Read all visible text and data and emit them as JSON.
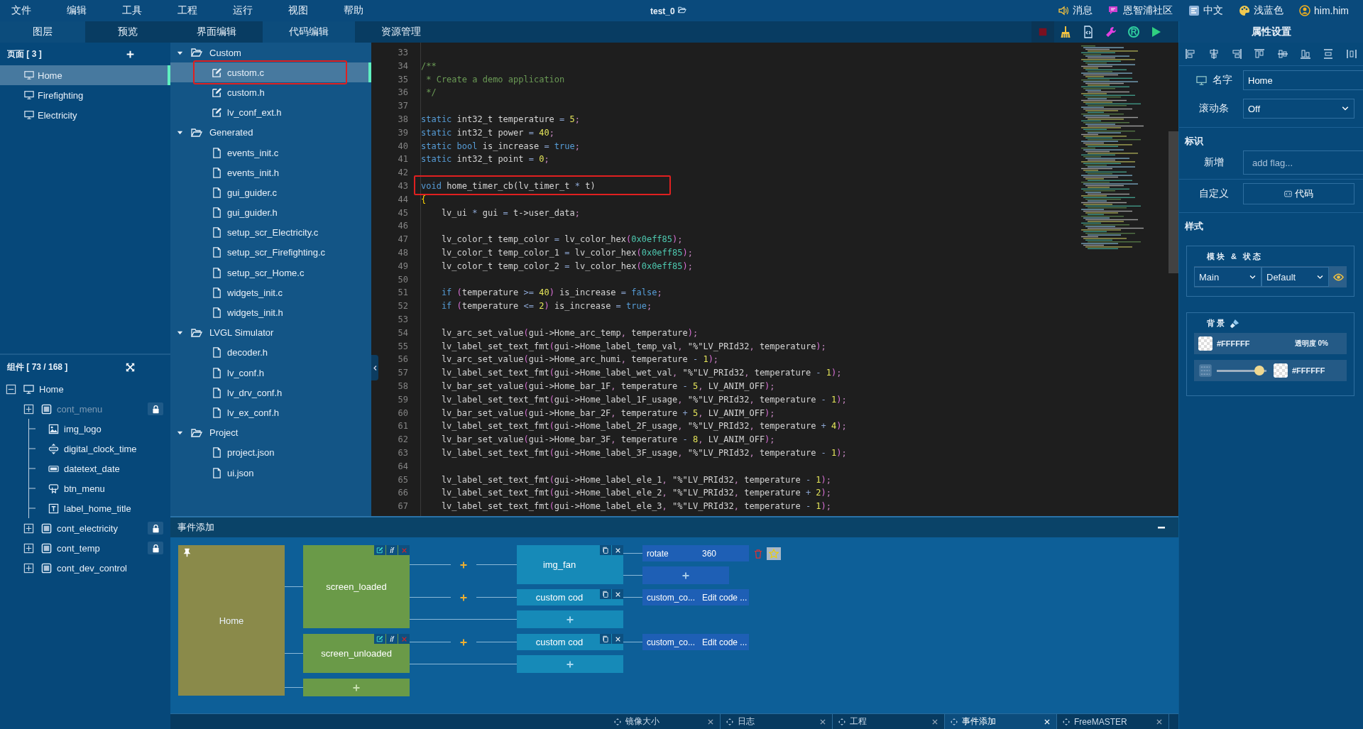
{
  "menubar": {
    "menus": [
      "文件",
      "编辑",
      "工具",
      "工程",
      "运行",
      "视图",
      "帮助"
    ],
    "project_title": "test_0",
    "right_items": [
      {
        "kind": "message",
        "label": "消息"
      },
      {
        "kind": "community",
        "label": "恩智浦社区"
      },
      {
        "kind": "language",
        "label": "中文"
      },
      {
        "kind": "theme",
        "label": "浅蓝色"
      },
      {
        "kind": "user",
        "label": "him.him"
      }
    ]
  },
  "left_tabs": [
    {
      "label": "图层",
      "selected": true
    },
    {
      "label": "预览",
      "selected": false
    }
  ],
  "center_tabs": [
    {
      "label": "界面编辑",
      "selected": false
    },
    {
      "label": "代码编辑",
      "selected": true
    },
    {
      "label": "资源管理",
      "selected": false
    }
  ],
  "toolbar": [
    {
      "kind": "stop"
    },
    {
      "kind": "clean"
    },
    {
      "kind": "export"
    },
    {
      "kind": "tools"
    },
    {
      "kind": "register",
      "label": "R"
    },
    {
      "kind": "run"
    }
  ],
  "pages": {
    "title": "页面 [ 3 ]",
    "items": [
      {
        "label": "Home",
        "selected": true
      },
      {
        "label": "Firefighting",
        "selected": false
      },
      {
        "label": "Electricity",
        "selected": false
      }
    ]
  },
  "components": {
    "title": "组件 [ 73 / 168 ]",
    "tree": [
      {
        "label": "Home",
        "kind": "screen",
        "collapsible": true,
        "expanded": true,
        "locked": false,
        "hidden": false,
        "children": [
          {
            "label": "cont_menu",
            "kind": "container",
            "collapsible": true,
            "expanded": false,
            "locked": true,
            "hidden": true
          },
          {
            "label": "img_logo",
            "kind": "image",
            "collapsible": false,
            "locked": false,
            "hidden": false
          },
          {
            "label": "digital_clock_time",
            "kind": "clock",
            "collapsible": false,
            "locked": false,
            "hidden": false
          },
          {
            "label": "datetext_date",
            "kind": "datetext",
            "collapsible": false,
            "locked": false,
            "hidden": false
          },
          {
            "label": "btn_menu",
            "kind": "button",
            "collapsible": false,
            "locked": false,
            "hidden": false
          },
          {
            "label": "label_home_title",
            "kind": "label",
            "collapsible": false,
            "locked": false,
            "hidden": false
          },
          {
            "label": "cont_electricity",
            "kind": "container",
            "collapsible": true,
            "expanded": false,
            "locked": true,
            "hidden": false
          },
          {
            "label": "cont_temp",
            "kind": "container",
            "collapsible": true,
            "expanded": false,
            "locked": true,
            "hidden": false
          },
          {
            "label": "cont_dev_control",
            "kind": "container",
            "collapsible": true,
            "expanded": false,
            "locked": false,
            "hidden": false
          }
        ]
      }
    ]
  },
  "file_tree": [
    {
      "label": "Custom",
      "expanded": true,
      "children": [
        {
          "label": "custom.c",
          "kind": "editable",
          "selected": true,
          "highlighted": true
        },
        {
          "label": "custom.h",
          "kind": "editable",
          "selected": false,
          "highlighted": false
        },
        {
          "label": "lv_conf_ext.h",
          "kind": "editable",
          "selected": false,
          "highlighted": false
        }
      ]
    },
    {
      "label": "Generated",
      "expanded": true,
      "children": [
        {
          "label": "events_init.c",
          "kind": "file",
          "selected": false,
          "highlighted": false
        },
        {
          "label": "events_init.h",
          "kind": "file",
          "selected": false,
          "highlighted": false
        },
        {
          "label": "gui_guider.c",
          "kind": "file",
          "selected": false,
          "highlighted": false
        },
        {
          "label": "gui_guider.h",
          "kind": "file",
          "selected": false,
          "highlighted": false
        },
        {
          "label": "setup_scr_Electricity.c",
          "kind": "file",
          "selected": false,
          "highlighted": false
        },
        {
          "label": "setup_scr_Firefighting.c",
          "kind": "file",
          "selected": false,
          "highlighted": false
        },
        {
          "label": "setup_scr_Home.c",
          "kind": "file",
          "selected": false,
          "highlighted": false
        },
        {
          "label": "widgets_init.c",
          "kind": "file",
          "selected": false,
          "highlighted": false
        },
        {
          "label": "widgets_init.h",
          "kind": "file",
          "selected": false,
          "highlighted": false
        }
      ]
    },
    {
      "label": "LVGL Simulator",
      "expanded": true,
      "children": [
        {
          "label": "decoder.h",
          "kind": "file",
          "selected": false,
          "highlighted": false
        },
        {
          "label": "lv_conf.h",
          "kind": "file",
          "selected": false,
          "highlighted": false
        },
        {
          "label": "lv_drv_conf.h",
          "kind": "file",
          "selected": false,
          "highlighted": false
        },
        {
          "label": "lv_ex_conf.h",
          "kind": "file",
          "selected": false,
          "highlighted": false
        }
      ]
    },
    {
      "label": "Project",
      "expanded": true,
      "children": [
        {
          "label": "project.json",
          "kind": "file",
          "selected": false,
          "highlighted": false
        },
        {
          "label": "ui.json",
          "kind": "file",
          "selected": false,
          "highlighted": false
        }
      ]
    }
  ],
  "editor": {
    "lines": [
      {
        "number": "33",
        "highlighted": false
      },
      {
        "number": "34",
        "highlighted": false,
        "tokens": [
          {
            "kind": "comment",
            "text": "/**"
          }
        ]
      },
      {
        "number": "35",
        "highlighted": false,
        "tokens": [
          {
            "kind": "comment",
            "text": " * Create a demo application"
          }
        ]
      },
      {
        "number": "36",
        "highlighted": false,
        "tokens": [
          {
            "kind": "comment",
            "text": " */"
          }
        ]
      },
      {
        "number": "37",
        "highlighted": false
      },
      {
        "number": "38",
        "highlighted": false,
        "tokens": [
          {
            "kind": "keyword",
            "text": "static "
          },
          {
            "kind": "plain",
            "text": "int32_t temperature "
          },
          {
            "kind": "operator",
            "text": "= "
          },
          {
            "kind": "number",
            "text": "5"
          },
          {
            "kind": "punct",
            "text": ";"
          }
        ]
      },
      {
        "number": "39",
        "highlighted": false,
        "tokens": [
          {
            "kind": "keyword",
            "text": "static "
          },
          {
            "kind": "plain",
            "text": "int32_t power "
          },
          {
            "kind": "operator",
            "text": "= "
          },
          {
            "kind": "number",
            "text": "40"
          },
          {
            "kind": "punct",
            "text": ";"
          }
        ]
      },
      {
        "number": "40",
        "highlighted": false,
        "tokens": [
          {
            "kind": "keyword",
            "text": "static bool "
          },
          {
            "kind": "plain",
            "text": "is_increase "
          },
          {
            "kind": "operator",
            "text": "= "
          },
          {
            "kind": "keyword",
            "text": "true"
          },
          {
            "kind": "punct",
            "text": ";"
          }
        ]
      },
      {
        "number": "41",
        "highlighted": false,
        "tokens": [
          {
            "kind": "keyword",
            "text": "static "
          },
          {
            "kind": "plain",
            "text": "int32_t point "
          },
          {
            "kind": "operator",
            "text": "= "
          },
          {
            "kind": "number",
            "text": "0"
          },
          {
            "kind": "punct",
            "text": ";"
          }
        ]
      },
      {
        "number": "42",
        "highlighted": false
      },
      {
        "number": "43",
        "highlighted": true,
        "tokens": [
          {
            "kind": "keyword",
            "text": "void "
          },
          {
            "kind": "plain",
            "text": "home_timer_cb(lv_timer_t "
          },
          {
            "kind": "operator",
            "text": "*"
          },
          {
            "kind": "plain",
            "text": " t)"
          }
        ]
      },
      {
        "number": "44",
        "highlighted": false,
        "tokens": [
          {
            "kind": "brace",
            "text": "{"
          }
        ]
      },
      {
        "number": "45",
        "highlighted": false,
        "tokens": [
          {
            "kind": "plain",
            "text": "    lv_ui "
          },
          {
            "kind": "operator",
            "text": "*"
          },
          {
            "kind": "plain",
            "text": " gui "
          },
          {
            "kind": "operator",
            "text": "="
          },
          {
            "kind": "plain",
            "text": " t->user_data"
          },
          {
            "kind": "punct",
            "text": ";"
          }
        ]
      },
      {
        "number": "46",
        "highlighted": false
      },
      {
        "number": "47",
        "highlighted": false,
        "tokens": [
          {
            "kind": "plain",
            "text": "    lv_color_t temp_color "
          },
          {
            "kind": "operator",
            "text": "="
          },
          {
            "kind": "plain",
            "text": " lv_color_hex"
          },
          {
            "kind": "paren",
            "text": "("
          },
          {
            "kind": "hex",
            "text": "0x0eff85"
          },
          {
            "kind": "paren",
            "text": ")"
          },
          {
            "kind": "punct",
            "text": ";"
          }
        ]
      },
      {
        "number": "48",
        "highlighted": false,
        "tokens": [
          {
            "kind": "plain",
            "text": "    lv_color_t temp_color_1 "
          },
          {
            "kind": "operator",
            "text": "="
          },
          {
            "kind": "plain",
            "text": " lv_color_hex"
          },
          {
            "kind": "paren",
            "text": "("
          },
          {
            "kind": "hex",
            "text": "0x0eff85"
          },
          {
            "kind": "paren",
            "text": ")"
          },
          {
            "kind": "punct",
            "text": ";"
          }
        ]
      },
      {
        "number": "49",
        "highlighted": false,
        "tokens": [
          {
            "kind": "plain",
            "text": "    lv_color_t temp_color_2 "
          },
          {
            "kind": "operator",
            "text": "="
          },
          {
            "kind": "plain",
            "text": " lv_color_hex"
          },
          {
            "kind": "paren",
            "text": "("
          },
          {
            "kind": "hex",
            "text": "0x0eff85"
          },
          {
            "kind": "paren",
            "text": ")"
          },
          {
            "kind": "punct",
            "text": ";"
          }
        ]
      },
      {
        "number": "50",
        "highlighted": false
      },
      {
        "number": "51",
        "highlighted": false,
        "tokens": [
          {
            "kind": "keyword",
            "text": "    if "
          },
          {
            "kind": "paren",
            "text": "("
          },
          {
            "kind": "plain",
            "text": "temperature "
          },
          {
            "kind": "operator",
            "text": ">="
          },
          {
            "kind": "number",
            "text": " 40"
          },
          {
            "kind": "paren",
            "text": ")"
          },
          {
            "kind": "plain",
            "text": " is_increase "
          },
          {
            "kind": "operator",
            "text": "="
          },
          {
            "kind": "keyword",
            "text": " false"
          },
          {
            "kind": "punct",
            "text": ";"
          }
        ]
      },
      {
        "number": "52",
        "highlighted": false,
        "tokens": [
          {
            "kind": "keyword",
            "text": "    if "
          },
          {
            "kind": "paren",
            "text": "("
          },
          {
            "kind": "plain",
            "text": "temperature "
          },
          {
            "kind": "operator",
            "text": "<="
          },
          {
            "kind": "number",
            "text": " 2"
          },
          {
            "kind": "paren",
            "text": ")"
          },
          {
            "kind": "plain",
            "text": " is_increase "
          },
          {
            "kind": "operator",
            "text": "="
          },
          {
            "kind": "keyword",
            "text": " true"
          },
          {
            "kind": "punct",
            "text": ";"
          }
        ]
      },
      {
        "number": "53",
        "highlighted": false
      },
      {
        "number": "54",
        "highlighted": false,
        "tokens": [
          {
            "kind": "plain",
            "text": "    lv_arc_set_value"
          },
          {
            "kind": "paren",
            "text": "("
          },
          {
            "kind": "plain",
            "text": "gui->Home_arc_temp"
          },
          {
            "kind": "punct",
            "text": ","
          },
          {
            "kind": "plain",
            "text": " temperature"
          },
          {
            "kind": "paren",
            "text": ")"
          },
          {
            "kind": "punct",
            "text": ";"
          }
        ]
      },
      {
        "number": "55",
        "highlighted": false,
        "tokens": [
          {
            "kind": "plain",
            "text": "    lv_label_set_text_fmt"
          },
          {
            "kind": "paren",
            "text": "("
          },
          {
            "kind": "plain",
            "text": "gui->Home_label_temp_val"
          },
          {
            "kind": "punct",
            "text": ","
          },
          {
            "kind": "string",
            "text": " \"%\""
          },
          {
            "kind": "plain",
            "text": "LV_PRId32"
          },
          {
            "kind": "punct",
            "text": ","
          },
          {
            "kind": "plain",
            "text": " temperature"
          },
          {
            "kind": "paren",
            "text": ")"
          },
          {
            "kind": "punct",
            "text": ";"
          }
        ]
      },
      {
        "number": "56",
        "highlighted": false,
        "tokens": [
          {
            "kind": "plain",
            "text": "    lv_arc_set_value"
          },
          {
            "kind": "paren",
            "text": "("
          },
          {
            "kind": "plain",
            "text": "gui->Home_arc_humi"
          },
          {
            "kind": "punct",
            "text": ","
          },
          {
            "kind": "plain",
            "text": " temperature "
          },
          {
            "kind": "operator",
            "text": "-"
          },
          {
            "kind": "number",
            "text": " 1"
          },
          {
            "kind": "paren",
            "text": ")"
          },
          {
            "kind": "punct",
            "text": ";"
          }
        ]
      },
      {
        "number": "57",
        "highlighted": false,
        "tokens": [
          {
            "kind": "plain",
            "text": "    lv_label_set_text_fmt"
          },
          {
            "kind": "paren",
            "text": "("
          },
          {
            "kind": "plain",
            "text": "gui->Home_label_wet_val"
          },
          {
            "kind": "punct",
            "text": ","
          },
          {
            "kind": "string",
            "text": " \"%\""
          },
          {
            "kind": "plain",
            "text": "LV_PRId32"
          },
          {
            "kind": "punct",
            "text": ","
          },
          {
            "kind": "plain",
            "text": " temperature "
          },
          {
            "kind": "operator",
            "text": "-"
          },
          {
            "kind": "number",
            "text": " 1"
          },
          {
            "kind": "paren",
            "text": ")"
          },
          {
            "kind": "punct",
            "text": ";"
          }
        ]
      },
      {
        "number": "58",
        "highlighted": false,
        "tokens": [
          {
            "kind": "plain",
            "text": "    lv_bar_set_value"
          },
          {
            "kind": "paren",
            "text": "("
          },
          {
            "kind": "plain",
            "text": "gui->Home_bar_1F"
          },
          {
            "kind": "punct",
            "text": ","
          },
          {
            "kind": "plain",
            "text": " temperature "
          },
          {
            "kind": "operator",
            "text": "-"
          },
          {
            "kind": "number",
            "text": " 5"
          },
          {
            "kind": "punct",
            "text": ","
          },
          {
            "kind": "plain",
            "text": " LV_ANIM_OFF"
          },
          {
            "kind": "paren",
            "text": ")"
          },
          {
            "kind": "punct",
            "text": ";"
          }
        ]
      },
      {
        "number": "59",
        "highlighted": false,
        "tokens": [
          {
            "kind": "plain",
            "text": "    lv_label_set_text_fmt"
          },
          {
            "kind": "paren",
            "text": "("
          },
          {
            "kind": "plain",
            "text": "gui->Home_label_1F_usage"
          },
          {
            "kind": "punct",
            "text": ","
          },
          {
            "kind": "string",
            "text": " \"%\""
          },
          {
            "kind": "plain",
            "text": "LV_PRId32"
          },
          {
            "kind": "punct",
            "text": ","
          },
          {
            "kind": "plain",
            "text": " temperature "
          },
          {
            "kind": "operator",
            "text": "-"
          },
          {
            "kind": "number",
            "text": " 1"
          },
          {
            "kind": "paren",
            "text": ")"
          },
          {
            "kind": "punct",
            "text": ";"
          }
        ]
      },
      {
        "number": "60",
        "highlighted": false,
        "tokens": [
          {
            "kind": "plain",
            "text": "    lv_bar_set_value"
          },
          {
            "kind": "paren",
            "text": "("
          },
          {
            "kind": "plain",
            "text": "gui->Home_bar_2F"
          },
          {
            "kind": "punct",
            "text": ","
          },
          {
            "kind": "plain",
            "text": " temperature "
          },
          {
            "kind": "operator",
            "text": "+"
          },
          {
            "kind": "number",
            "text": " 5"
          },
          {
            "kind": "punct",
            "text": ","
          },
          {
            "kind": "plain",
            "text": " LV_ANIM_OFF"
          },
          {
            "kind": "paren",
            "text": ")"
          },
          {
            "kind": "punct",
            "text": ";"
          }
        ]
      },
      {
        "number": "61",
        "highlighted": false,
        "tokens": [
          {
            "kind": "plain",
            "text": "    lv_label_set_text_fmt"
          },
          {
            "kind": "paren",
            "text": "("
          },
          {
            "kind": "plain",
            "text": "gui->Home_label_2F_usage"
          },
          {
            "kind": "punct",
            "text": ","
          },
          {
            "kind": "string",
            "text": " \"%\""
          },
          {
            "kind": "plain",
            "text": "LV_PRId32"
          },
          {
            "kind": "punct",
            "text": ","
          },
          {
            "kind": "plain",
            "text": " temperature "
          },
          {
            "kind": "operator",
            "text": "+"
          },
          {
            "kind": "number",
            "text": " 4"
          },
          {
            "kind": "paren",
            "text": ")"
          },
          {
            "kind": "punct",
            "text": ";"
          }
        ]
      },
      {
        "number": "62",
        "highlighted": false,
        "tokens": [
          {
            "kind": "plain",
            "text": "    lv_bar_set_value"
          },
          {
            "kind": "paren",
            "text": "("
          },
          {
            "kind": "plain",
            "text": "gui->Home_bar_3F"
          },
          {
            "kind": "punct",
            "text": ","
          },
          {
            "kind": "plain",
            "text": " temperature "
          },
          {
            "kind": "operator",
            "text": "-"
          },
          {
            "kind": "number",
            "text": " 8"
          },
          {
            "kind": "punct",
            "text": ","
          },
          {
            "kind": "plain",
            "text": " LV_ANIM_OFF"
          },
          {
            "kind": "paren",
            "text": ")"
          },
          {
            "kind": "punct",
            "text": ";"
          }
        ]
      },
      {
        "number": "63",
        "highlighted": false,
        "tokens": [
          {
            "kind": "plain",
            "text": "    lv_label_set_text_fmt"
          },
          {
            "kind": "paren",
            "text": "("
          },
          {
            "kind": "plain",
            "text": "gui->Home_label_3F_usage"
          },
          {
            "kind": "punct",
            "text": ","
          },
          {
            "kind": "string",
            "text": " \"%\""
          },
          {
            "kind": "plain",
            "text": "LV_PRId32"
          },
          {
            "kind": "punct",
            "text": ","
          },
          {
            "kind": "plain",
            "text": " temperature "
          },
          {
            "kind": "operator",
            "text": "-"
          },
          {
            "kind": "number",
            "text": " 1"
          },
          {
            "kind": "paren",
            "text": ")"
          },
          {
            "kind": "punct",
            "text": ";"
          }
        ]
      },
      {
        "number": "64",
        "highlighted": false
      },
      {
        "number": "65",
        "highlighted": false,
        "tokens": [
          {
            "kind": "plain",
            "text": "    lv_label_set_text_fmt"
          },
          {
            "kind": "paren",
            "text": "("
          },
          {
            "kind": "plain",
            "text": "gui->Home_label_ele_1"
          },
          {
            "kind": "punct",
            "text": ","
          },
          {
            "kind": "string",
            "text": " \"%\""
          },
          {
            "kind": "plain",
            "text": "LV_PRId32"
          },
          {
            "kind": "punct",
            "text": ","
          },
          {
            "kind": "plain",
            "text": " temperature "
          },
          {
            "kind": "operator",
            "text": "-"
          },
          {
            "kind": "number",
            "text": " 1"
          },
          {
            "kind": "paren",
            "text": ")"
          },
          {
            "kind": "punct",
            "text": ";"
          }
        ]
      },
      {
        "number": "66",
        "highlighted": false,
        "tokens": [
          {
            "kind": "plain",
            "text": "    lv_label_set_text_fmt"
          },
          {
            "kind": "paren",
            "text": "("
          },
          {
            "kind": "plain",
            "text": "gui->Home_label_ele_2"
          },
          {
            "kind": "punct",
            "text": ","
          },
          {
            "kind": "string",
            "text": " \"%\""
          },
          {
            "kind": "plain",
            "text": "LV_PRId32"
          },
          {
            "kind": "punct",
            "text": ","
          },
          {
            "kind": "plain",
            "text": " temperature "
          },
          {
            "kind": "operator",
            "text": "+"
          },
          {
            "kind": "number",
            "text": " 2"
          },
          {
            "kind": "paren",
            "text": ")"
          },
          {
            "kind": "punct",
            "text": ";"
          }
        ]
      },
      {
        "number": "67",
        "highlighted": false,
        "tokens": [
          {
            "kind": "plain",
            "text": "    lv_label_set_text_fmt"
          },
          {
            "kind": "paren",
            "text": "("
          },
          {
            "kind": "plain",
            "text": "gui->Home_label_ele_3"
          },
          {
            "kind": "punct",
            "text": ","
          },
          {
            "kind": "string",
            "text": " \"%\""
          },
          {
            "kind": "plain",
            "text": "LV_PRId32"
          },
          {
            "kind": "punct",
            "text": ","
          },
          {
            "kind": "plain",
            "text": " temperature "
          },
          {
            "kind": "operator",
            "text": "-"
          },
          {
            "kind": "number",
            "text": " 1"
          },
          {
            "kind": "paren",
            "text": ")"
          },
          {
            "kind": "punct",
            "text": ";"
          }
        ]
      }
    ]
  },
  "event_panel": {
    "title": "事件添加",
    "screen": "Home",
    "events": [
      {
        "name": "screen_loaded",
        "condition_label": "if",
        "actions": [
          {
            "target": "img_fan",
            "params": [
              {
                "name": "rotate",
                "value": "360"
              }
            ],
            "can_add_param": true
          },
          {
            "target": "custom cod",
            "params": [
              {
                "name": "custom_co...",
                "value": "Edit code ..."
              }
            ],
            "can_add_param": false
          }
        ]
      },
      {
        "name": "screen_unloaded",
        "condition_label": "if",
        "actions": [
          {
            "target": "custom cod",
            "params": [
              {
                "name": "custom_co...",
                "value": "Edit code ..."
              }
            ],
            "can_add_param": false
          }
        ]
      }
    ]
  },
  "properties": {
    "title": "属性设置",
    "name_label": "名字",
    "name_value": "Home",
    "scroll_label": "滚动条",
    "scroll_value": "Off",
    "flags_title": "标识",
    "add_label": "新增",
    "add_placeholder": "add flag...",
    "custom_label": "自定义",
    "code_button": "代码",
    "style_title": "样式",
    "part_state_legend": "模块 & 状态",
    "part": "Main",
    "state": "Default",
    "background_legend": "背景",
    "bg_color": "#FFFFFF",
    "opacity": "透明度 0%",
    "gradient": {
      "level": 0.95,
      "hex_label": "#FFFFFF"
    }
  },
  "dock_tabs": [
    {
      "label": "镜像大小",
      "selected": false
    },
    {
      "label": "日志",
      "selected": false
    },
    {
      "label": "工程",
      "selected": false
    },
    {
      "label": "事件添加",
      "selected": true
    },
    {
      "label": "FreeMASTER",
      "selected": false
    }
  ]
}
